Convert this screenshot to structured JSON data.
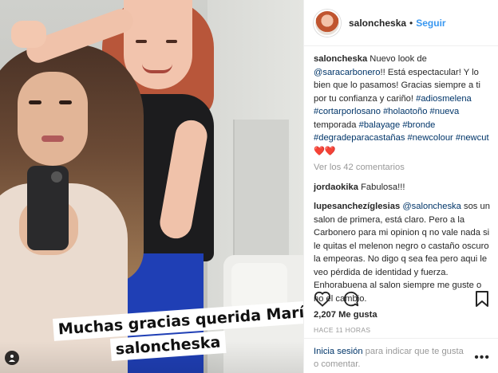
{
  "post": {
    "username": "saloncheska",
    "follow_dot": "•",
    "follow_label": "Seguir",
    "sticker_line1": "Muchas gracias querida María",
    "sticker_line2": "saloncheska"
  },
  "caption": {
    "username": "saloncheska",
    "text_before": " Nuevo look de ",
    "mention": "@saracarbonero",
    "text_after": "!! Está espectacular! Y lo bien que lo pasamos! Gracias siempre a ti por tu confianza y cariño! ",
    "hashtags1": "#adiosmelena #cortarporlosano #holaotoño #nueva",
    "plain1": " temporada ",
    "hashtags2": "#balayage #bronde #degradeparacastañas #newcolour #newcut",
    "emoji": " ❤️❤️"
  },
  "view_comments": "Ver los 42 comentarios",
  "comments": [
    {
      "username": "jordaokika",
      "text": " Fabulosa!!!"
    },
    {
      "username": "lupesanchezíglesias",
      "mention": "@saloncheska",
      "text": " sos un salon de primera, está claro. Pero a la Carbonero para mi opinion q no vale nada si le quitas el melenon negro o castaño oscuro la empeoras. No digo q sea fea pero aqui le veo pérdida de identidad y fuerza. Enhorabuena al salon siempre me guste o no el cambio."
    }
  ],
  "icons": {
    "like": "heart-icon",
    "comment": "comment-bubble-icon",
    "bookmark": "bookmark-icon",
    "tag": "person-tag-icon",
    "options": "more-options-icon"
  },
  "likes": "2,207 Me gusta",
  "timestamp": "HACE 11 HORAS",
  "login": {
    "link": "Inicia sesión",
    "text": " para indicar que te gusta o comentar.",
    "options": "•••"
  },
  "colors": {
    "link_blue": "#3897f0",
    "hashtag_blue": "#003569",
    "muted": "#999999",
    "border": "#efefef"
  }
}
